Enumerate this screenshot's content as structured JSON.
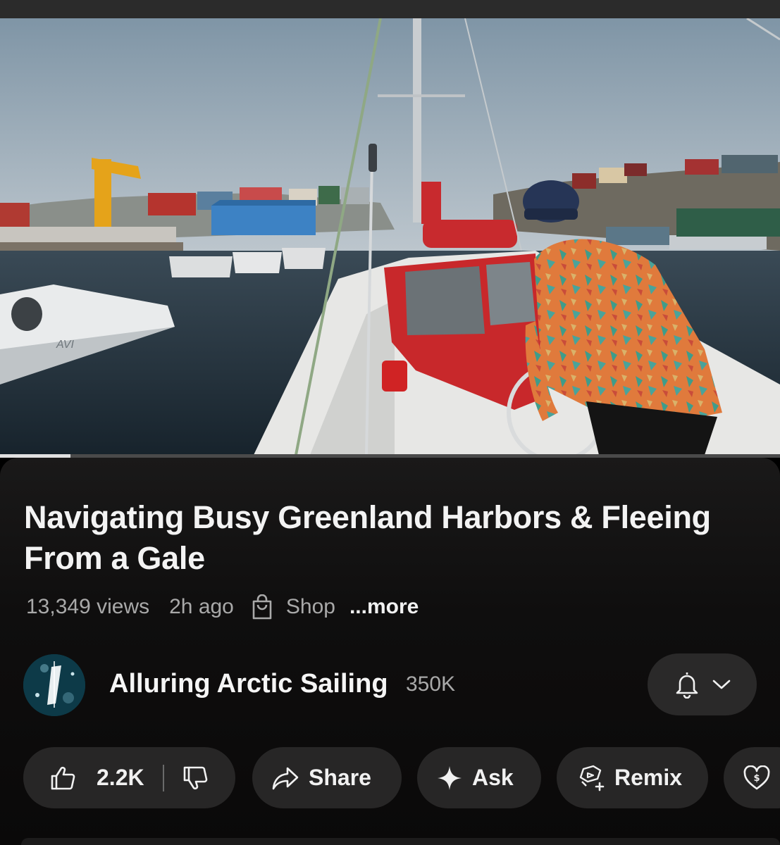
{
  "video": {
    "title": "Navigating Busy Greenland Harbors & Fleeing From a Gale",
    "progress_fraction": 0.09,
    "boat_hull_text": "AVI"
  },
  "meta": {
    "views": "13,349 views",
    "time": "2h ago",
    "shop_label": "Shop",
    "more_label": "...more"
  },
  "channel": {
    "name": "Alluring Arctic Sailing",
    "subscribers": "350K"
  },
  "actions": {
    "like_count": "2.2K",
    "share_label": "Share",
    "ask_label": "Ask",
    "remix_label": "Remix"
  },
  "icons": {
    "shop": "shopping-bag-icon",
    "bell": "bell-icon",
    "chevron": "chevron-down-icon",
    "like": "thumbs-up-icon",
    "dislike": "thumbs-down-icon",
    "share": "share-arrow-icon",
    "ask": "sparkle-icon",
    "remix": "remix-icon",
    "thanks": "heart-dollar-icon"
  },
  "colors": {
    "background": "#000000",
    "pill": "#272626",
    "text_primary": "#f1f1f1",
    "text_secondary": "#a9a9a9"
  }
}
